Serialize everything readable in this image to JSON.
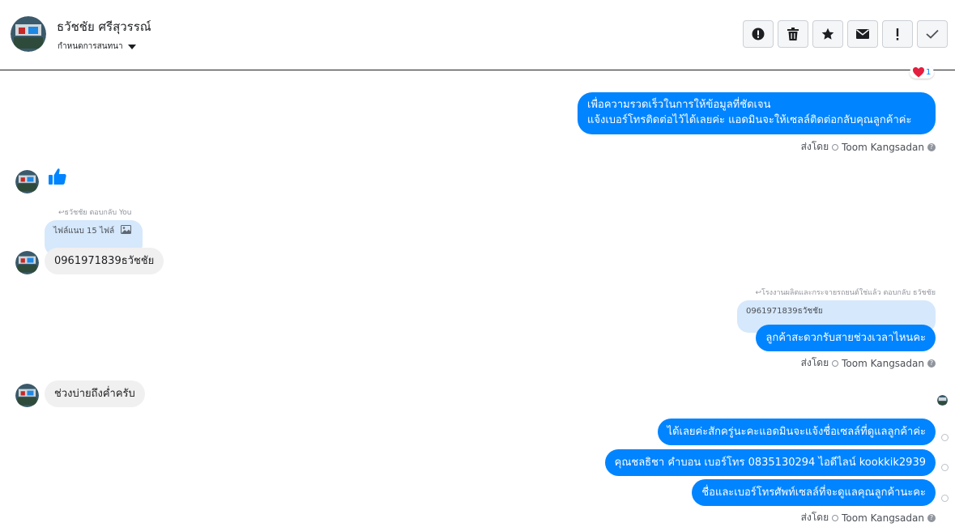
{
  "header": {
    "contact_name": "ธวัชชัย ศรีสุวรรณ์",
    "subtitle": "กำหนดการสนทนา",
    "actions": [
      "alert-icon",
      "trash-icon",
      "star-icon",
      "envelope-icon",
      "exclamation-icon",
      "check-icon"
    ]
  },
  "reaction": {
    "emoji": "heart-icon",
    "count": "1"
  },
  "messages": {
    "m1": {
      "line1": "เพื่อความรวดเร็วในการให้ข้อมูลที่ชัดเจน",
      "line2": "แจ้งเบอร์โทรติดต่อไว้ได้เลยค่ะ แอดมินจะให้เซลล์ติดต่อกลับคุณลูกค้าค่ะ"
    },
    "sent_by_prefix": "ส่งโดย",
    "sent_by_name": "Toom Kangsadan",
    "reply1": {
      "meta": "ธวัชชัย ตอบกลับ You",
      "quote": "ไฟล์แนบ 15 ไฟล์",
      "text": "0961971839ธวัชชัย"
    },
    "reply2": {
      "meta": "โรงงานผลิตและกระจายรถยนต์ใช่แล้ว ตอบกลับ ธวัชชัย",
      "quote": "0961971839ธวัชชัย",
      "text": "ลูกค้าสะดวกรับสายช่วงเวลาไหนคะ"
    },
    "in2": "ช่วงบ่ายถึงค่ำครับ",
    "out3": "ได้เลยค่ะสักครู่นะคะแอดมินจะแจ้งชื่อเซลล์ที่ดูแลลูกค้าค่ะ",
    "out4": "คุณชลธิชา คำบอน เบอร์โทร 0835130294 ไอดีไลน์ kookkik2939",
    "out5": "ชื่อและเบอร์โทรศัพท์เซลล์ที่จะดูแลคุณลูกค้านะคะ"
  },
  "colors": {
    "outgoing": "#0084ff",
    "incoming": "#f1f0f0",
    "quote": "#d6e8fb"
  }
}
